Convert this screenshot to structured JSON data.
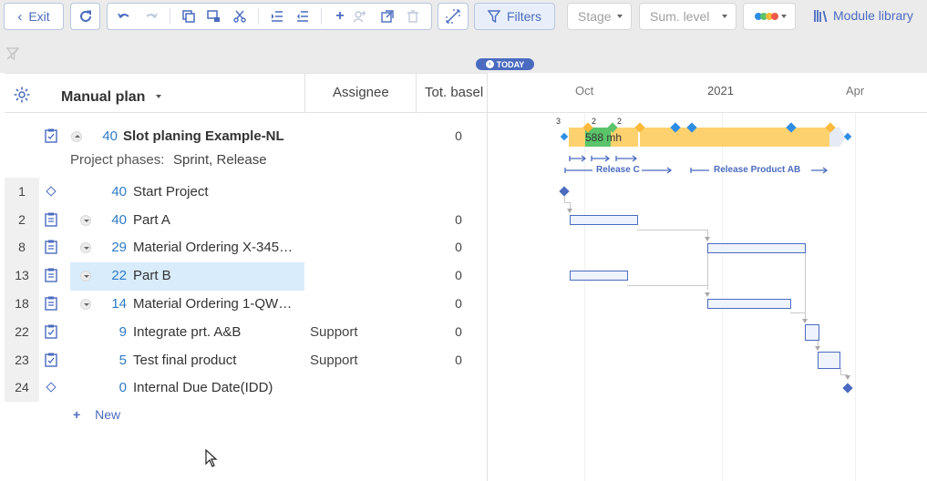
{
  "toolbar": {
    "exit_label": "Exit",
    "filters_label": "Filters",
    "stage_placeholder": "Stage",
    "sum_level_placeholder": "Sum. level",
    "module_library_label": "Module library"
  },
  "timeline": {
    "today_label": "TODAY",
    "months": [
      "Oct",
      "2021",
      "Apr"
    ]
  },
  "grid": {
    "columns": {
      "name": "Manual plan",
      "assignee": "Assignee",
      "baseline": "Tot. basel"
    },
    "project": {
      "id": "40",
      "name": "Slot planing Example-NL",
      "baseline": "0",
      "phases_label": "Project phases:",
      "phases_value": "Sprint, Release"
    },
    "rows": [
      {
        "num": "1",
        "id": "40",
        "name": "Start Project",
        "assignee": "",
        "baseline": ""
      },
      {
        "num": "2",
        "id": "40",
        "name": "Part A",
        "assignee": "",
        "baseline": "0"
      },
      {
        "num": "8",
        "id": "29",
        "name": "Material Ordering X-345…",
        "assignee": "",
        "baseline": "0"
      },
      {
        "num": "13",
        "id": "22",
        "name": "Part B",
        "assignee": "",
        "baseline": "0"
      },
      {
        "num": "18",
        "id": "14",
        "name": "Material Ordering 1-QW…",
        "assignee": "",
        "baseline": "0"
      },
      {
        "num": "22",
        "id": "9",
        "name": "Integrate prt. A&B",
        "assignee": "Support",
        "baseline": "0"
      },
      {
        "num": "23",
        "id": "5",
        "name": "Test final product",
        "assignee": "Support",
        "baseline": "0"
      },
      {
        "num": "24",
        "id": "0",
        "name": "Internal Due Date(IDD)",
        "assignee": "",
        "baseline": ""
      }
    ],
    "new_label": "New"
  },
  "gantt": {
    "summary_label": "588 mh",
    "milestone_counts": [
      "3",
      "2",
      "2"
    ],
    "release_labels": [
      "Release C",
      "Release Product AB"
    ]
  },
  "colors": {
    "accent": "#4a6bbf",
    "id_blue": "#2e7bc6",
    "selected_row": "#d9ecfb",
    "summary_bar": "#fdd26e",
    "summary_green": "#5bc46a",
    "milestone_blue": "#2d8de4"
  }
}
